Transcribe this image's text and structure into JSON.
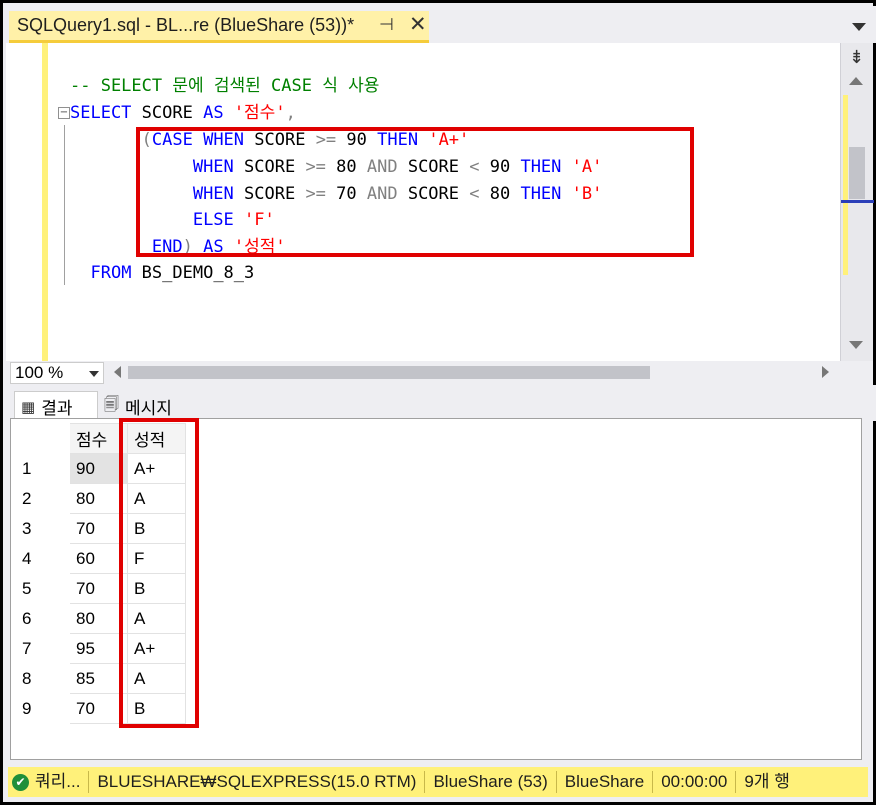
{
  "tab": {
    "title": "SQLQuery1.sql - BL...re (BlueShare (53))*",
    "pin_glyph": "⊣",
    "close_glyph": "✕"
  },
  "editor": {
    "lines": [
      {
        "tokens": [
          {
            "t": "-- SELECT 문에 검색된 CASE 식 사용",
            "c": "cm"
          }
        ]
      },
      {
        "tokens": [
          {
            "t": "SELECT",
            "c": "kw"
          },
          {
            "t": " SCORE ",
            "c": "df"
          },
          {
            "t": "AS",
            "c": "kw"
          },
          {
            "t": " ",
            "c": "df"
          },
          {
            "t": "'점수'",
            "c": "st"
          },
          {
            "t": ",",
            "c": "op"
          }
        ]
      },
      {
        "tokens": [
          {
            "t": "       ",
            "c": "df"
          },
          {
            "t": "(",
            "c": "op"
          },
          {
            "t": "CASE WHEN",
            "c": "kw"
          },
          {
            "t": " SCORE ",
            "c": "df"
          },
          {
            "t": ">=",
            "c": "op"
          },
          {
            "t": " 90 ",
            "c": "df"
          },
          {
            "t": "THEN",
            "c": "kw"
          },
          {
            "t": " ",
            "c": "df"
          },
          {
            "t": "'A+'",
            "c": "st"
          }
        ]
      },
      {
        "tokens": [
          {
            "t": "            ",
            "c": "df"
          },
          {
            "t": "WHEN",
            "c": "kw"
          },
          {
            "t": " SCORE ",
            "c": "df"
          },
          {
            "t": ">=",
            "c": "op"
          },
          {
            "t": " 80 ",
            "c": "df"
          },
          {
            "t": "AND",
            "c": "op"
          },
          {
            "t": " SCORE ",
            "c": "df"
          },
          {
            "t": "<",
            "c": "op"
          },
          {
            "t": " 90 ",
            "c": "df"
          },
          {
            "t": "THEN",
            "c": "kw"
          },
          {
            "t": " ",
            "c": "df"
          },
          {
            "t": "'A'",
            "c": "st"
          }
        ]
      },
      {
        "tokens": [
          {
            "t": "            ",
            "c": "df"
          },
          {
            "t": "WHEN",
            "c": "kw"
          },
          {
            "t": " SCORE ",
            "c": "df"
          },
          {
            "t": ">=",
            "c": "op"
          },
          {
            "t": " 70 ",
            "c": "df"
          },
          {
            "t": "AND",
            "c": "op"
          },
          {
            "t": " SCORE ",
            "c": "df"
          },
          {
            "t": "<",
            "c": "op"
          },
          {
            "t": " 80 ",
            "c": "df"
          },
          {
            "t": "THEN",
            "c": "kw"
          },
          {
            "t": " ",
            "c": "df"
          },
          {
            "t": "'B'",
            "c": "st"
          }
        ]
      },
      {
        "tokens": [
          {
            "t": "            ",
            "c": "df"
          },
          {
            "t": "ELSE",
            "c": "kw"
          },
          {
            "t": " ",
            "c": "df"
          },
          {
            "t": "'F'",
            "c": "st"
          }
        ]
      },
      {
        "tokens": [
          {
            "t": "        ",
            "c": "df"
          },
          {
            "t": "END",
            "c": "kw"
          },
          {
            "t": ")",
            "c": "op"
          },
          {
            "t": " ",
            "c": "df"
          },
          {
            "t": "AS",
            "c": "kw"
          },
          {
            "t": " ",
            "c": "df"
          },
          {
            "t": "'성적'",
            "c": "st"
          }
        ]
      },
      {
        "tokens": [
          {
            "t": "  ",
            "c": "df"
          },
          {
            "t": "FROM",
            "c": "kw"
          },
          {
            "t": " BS_DEMO_8_3",
            "c": "df"
          }
        ]
      }
    ]
  },
  "zoom": {
    "value": "100 %"
  },
  "results_tabs": {
    "results_label": "결과",
    "messages_label": "메시지"
  },
  "grid": {
    "columns": [
      "점수",
      "성적"
    ],
    "rows": [
      [
        "1",
        "90",
        "A+"
      ],
      [
        "2",
        "80",
        "A"
      ],
      [
        "3",
        "70",
        "B"
      ],
      [
        "4",
        "60",
        "F"
      ],
      [
        "5",
        "70",
        "B"
      ],
      [
        "6",
        "80",
        "A"
      ],
      [
        "7",
        "95",
        "A+"
      ],
      [
        "8",
        "85",
        "A"
      ],
      [
        "9",
        "70",
        "B"
      ]
    ]
  },
  "status": {
    "query_state": "쿼리...",
    "server": "BLUESHARE₩SQLEXPRESS(15.0 RTM)",
    "login": "BlueShare (53)",
    "database": "BlueShare",
    "elapsed": "00:00:00",
    "row_count": "9개 행"
  },
  "colors": {
    "tab_active": "#fff1a8",
    "status_bar": "#fff17a",
    "highlight_box": "#e00000",
    "keyword": "#0000ff",
    "string": "#ff0000",
    "comment": "#008000"
  },
  "icons": [
    "pin-icon",
    "tab-close-icon",
    "split-icon",
    "grid-icon",
    "messages-icon",
    "status-ok-icon"
  ]
}
